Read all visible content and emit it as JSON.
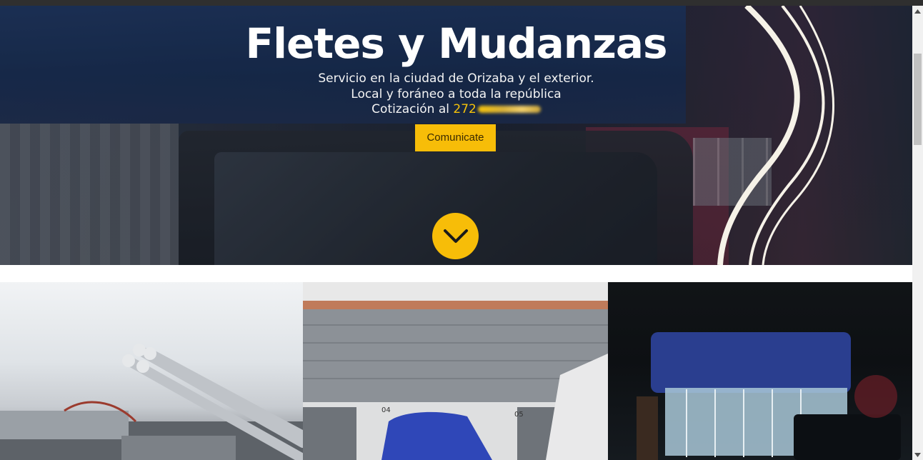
{
  "hero": {
    "title": "Fletes y Mudanzas",
    "line1": "Servicio en la ciudad de Orizaba y el exterior.",
    "line2": "Local y foráneo a toda la república",
    "line3_prefix": "Cotización al ",
    "phone_visible": "272",
    "cta_label": "Comunicate",
    "accent_color": "#f7bd08",
    "scroll_icon": "chevron-down-icon"
  },
  "gallery": {
    "tiles": [
      {
        "label": "",
        "icon": "photo-tubes-icon"
      },
      {
        "label": "",
        "icon": "photo-warehouse-icon"
      },
      {
        "label": "",
        "icon": "photo-night-truck-icon"
      }
    ],
    "tile2_sign_a": "04",
    "tile2_sign_b": "05"
  }
}
